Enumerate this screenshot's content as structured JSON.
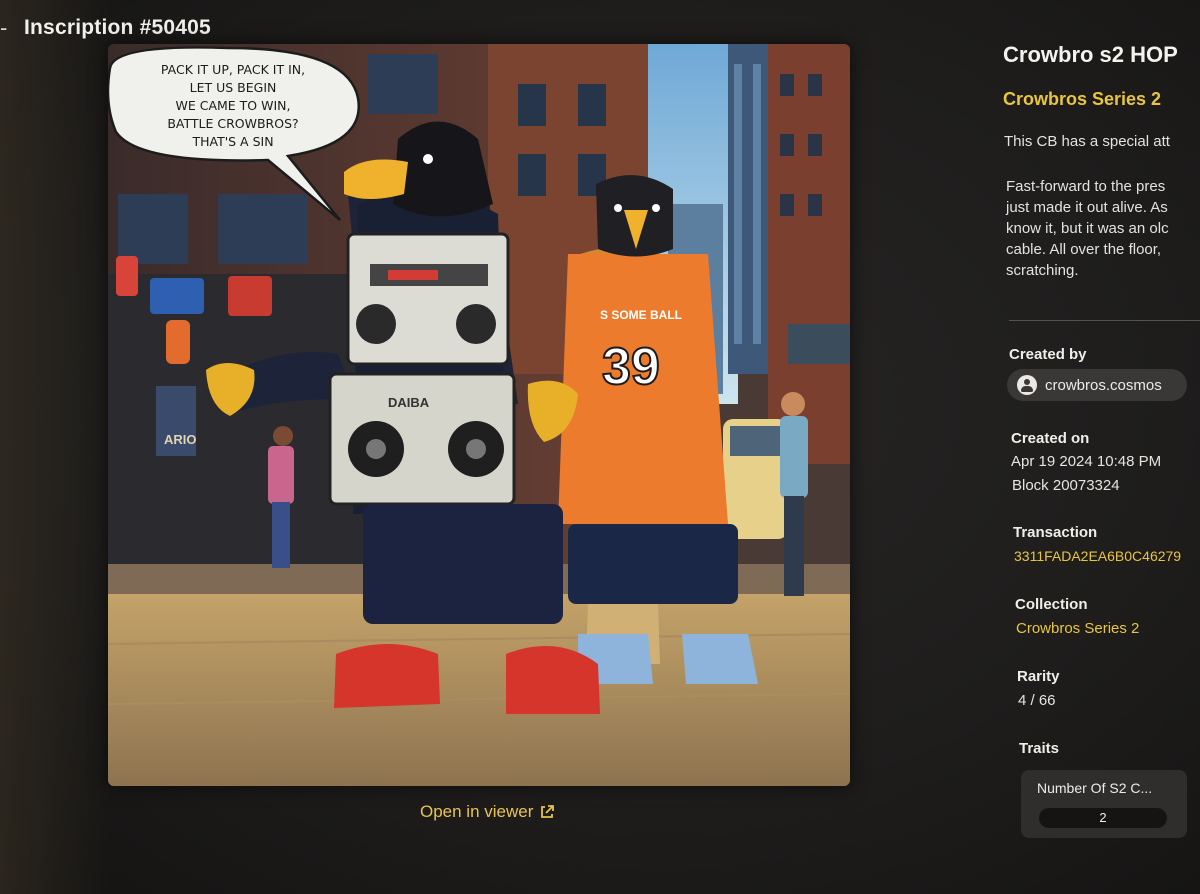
{
  "header": {
    "back_glyph": "-",
    "title": "Inscription #50405"
  },
  "artwork": {
    "speech_bubble": [
      "PACK IT UP, PACK IT IN,",
      "LET US BEGIN",
      "WE CAME TO WIN,",
      "BATTLE CROWBROS?",
      "THAT'S A SIN"
    ],
    "jersey_number": "39",
    "jersey_text": "S SOME BALL",
    "boombox_text": "DAIBA",
    "sign_text": "ARIO"
  },
  "open_viewer": {
    "label": "Open in viewer",
    "icon": "external-link-icon"
  },
  "details": {
    "name": "Crowbro s2 HOP",
    "series": "Crowbros Series 2",
    "description_intro": "This CB has a special att",
    "description_lines": [
      "Fast-forward to the pres",
      "just made it out alive. As",
      "know it, but it was an olc",
      "cable.  All over the floor,",
      "scratching."
    ],
    "created_by_label": "Created by",
    "creator": "crowbros.cosmos",
    "created_on_label": "Created on",
    "created_on_date": "Apr 19 2024 10:48 PM",
    "block": "Block 20073324",
    "transaction_label": "Transaction",
    "transaction_hash": "3311FADA2EA6B0C46279",
    "collection_label": "Collection",
    "collection": "Crowbros Series 2",
    "rarity_label": "Rarity",
    "rarity": "4 / 66",
    "traits_label": "Traits",
    "traits": [
      {
        "name": "Number Of S2 C...",
        "value": "2"
      }
    ]
  },
  "colors": {
    "accent": "#e9c53f",
    "background": "#1e1d1c"
  }
}
